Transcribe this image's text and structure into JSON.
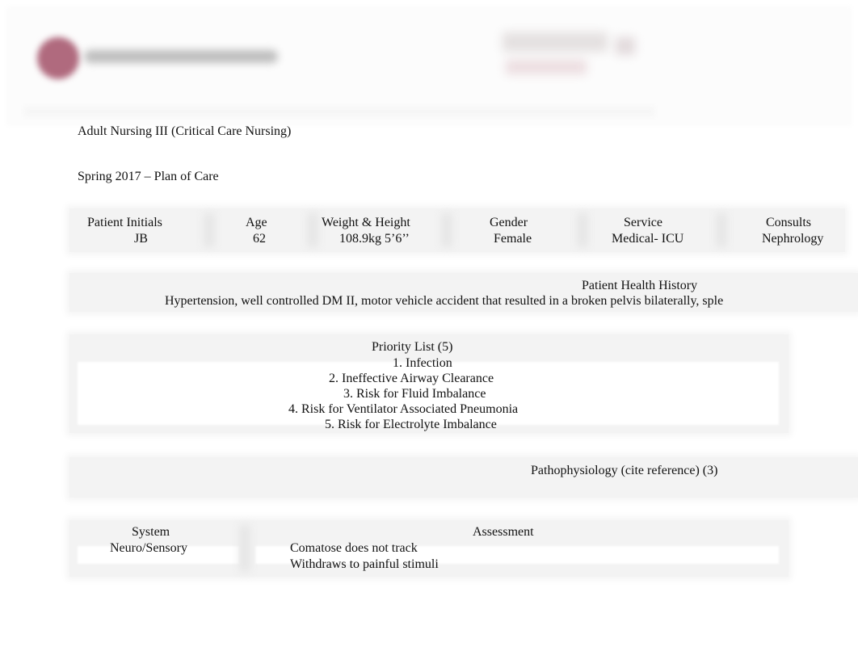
{
  "header": {
    "logo_icon": "institution-logo-icon",
    "badge_icon": "accreditation-badge-icon"
  },
  "document": {
    "course_title": "Adult Nursing III (Critical Care Nursing)",
    "term_title": "Spring 2017 – Plan of Care"
  },
  "patient_info": {
    "columns": [
      {
        "label": "Patient Initials",
        "value": "JB"
      },
      {
        "label": "Age",
        "value": "62"
      },
      {
        "label": "Weight & Height",
        "value": "108.9kg 5’6’’"
      },
      {
        "label": "Gender",
        "value": "Female"
      },
      {
        "label": "Service",
        "value": "Medical- ICU"
      },
      {
        "label": "Consults",
        "value": "Nephrology"
      }
    ]
  },
  "health_history": {
    "title": "Patient Health History",
    "text": "Hypertension, well controlled DM II, motor vehicle accident that resulted in a broken pelvis bilaterally, sple"
  },
  "priority_list": {
    "title": "Priority List (5)",
    "items": [
      "1. Infection",
      "2. Ineffective Airway Clearance",
      "3. Risk for Fluid Imbalance",
      "4. Risk for Ventilator Associated Pneumonia",
      "5. Risk for Electrolyte Imbalance"
    ]
  },
  "pathophysiology": {
    "title": "Pathophysiology (cite reference) (3)"
  },
  "assessment_table": {
    "headers": {
      "system": "System",
      "assessment": "Assessment"
    },
    "rows": [
      {
        "system": "Neuro/Sensory",
        "bullet_glyph": "",
        "findings": [
          "Comatose does not track",
          "Withdraws to painful stimuli"
        ]
      }
    ]
  }
}
